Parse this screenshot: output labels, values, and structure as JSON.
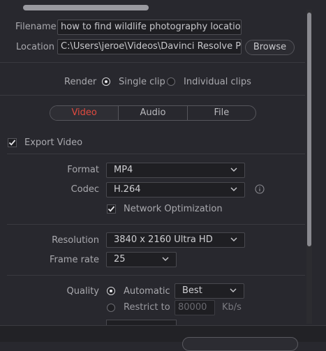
{
  "file": {
    "filename_label": "Filename",
    "filename_value": "how to find wildlife photography locations",
    "location_label": "Location",
    "location_value": "C:\\Users\\jeroe\\Videos\\Davinci Resolve Proje",
    "browse_label": "Browse"
  },
  "render": {
    "label": "Render",
    "single_clip": "Single clip",
    "individual_clips": "Individual clips",
    "selected": "single_clip"
  },
  "tabs": [
    "Video",
    "Audio",
    "File"
  ],
  "active_tab": "Video",
  "export_video": {
    "label": "Export Video",
    "checked": true
  },
  "format": {
    "label": "Format",
    "value": "MP4"
  },
  "codec": {
    "label": "Codec",
    "value": "H.264"
  },
  "network_optimization": {
    "label": "Network Optimization",
    "checked": true
  },
  "resolution": {
    "label": "Resolution",
    "value": "3840 x 2160 Ultra HD"
  },
  "frame_rate": {
    "label": "Frame rate",
    "value": "25"
  },
  "quality": {
    "label": "Quality",
    "automatic_label": "Automatic",
    "automatic_value": "Best",
    "restrict_label": "Restrict to",
    "restrict_value": "80000",
    "restrict_unit": "Kb/s",
    "selected": "automatic"
  },
  "colors": {
    "accent": "#e04a3f",
    "background": "#28282e"
  }
}
